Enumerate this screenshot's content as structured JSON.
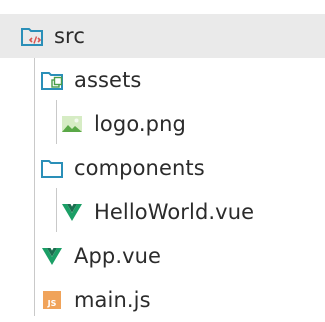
{
  "explorer": {
    "items": [
      {
        "label": "src",
        "icon": "folder-src-icon"
      },
      {
        "label": "assets",
        "icon": "folder-assets-icon"
      },
      {
        "label": "logo.png",
        "icon": "image-file-icon"
      },
      {
        "label": "components",
        "icon": "folder-icon"
      },
      {
        "label": "HelloWorld.vue",
        "icon": "vue-file-icon"
      },
      {
        "label": "App.vue",
        "icon": "vue-file-icon"
      },
      {
        "label": "main.js",
        "icon": "js-file-icon",
        "icon_text": "JS"
      }
    ]
  },
  "colors": {
    "folder": "#2a8fb8",
    "vue": "#1b9f66",
    "js": "#f0a35a",
    "image_sky": "#8ac870",
    "selection": "#eaeaea"
  }
}
